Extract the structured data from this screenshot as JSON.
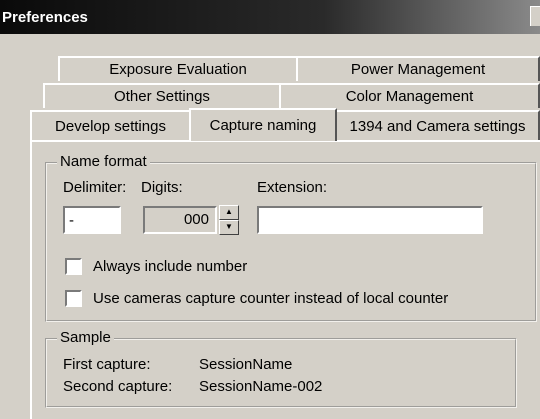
{
  "window": {
    "title": "Preferences"
  },
  "tabs": {
    "row1": [
      "Exposure Evaluation",
      "Power Management"
    ],
    "row2": [
      "Other Settings",
      "Color Management"
    ],
    "row3": [
      "Develop settings",
      "Capture naming",
      "1394 and Camera settings"
    ],
    "active": "Capture naming"
  },
  "name_format": {
    "legend": "Name format",
    "delimiter_label": "Delimiter:",
    "digits_label": "Digits:",
    "extension_label": "Extension:",
    "delimiter_value": "-",
    "digits_value": "000",
    "extension_value": "",
    "always_include_number": {
      "label": "Always include number",
      "checked": false
    },
    "use_camera_counter": {
      "label": "Use cameras capture counter instead of local counter",
      "checked": false
    }
  },
  "sample": {
    "legend": "Sample",
    "first_label": "First capture:",
    "first_value": "SessionName",
    "second_label": "Second capture:",
    "second_value": "SessionName-002"
  }
}
